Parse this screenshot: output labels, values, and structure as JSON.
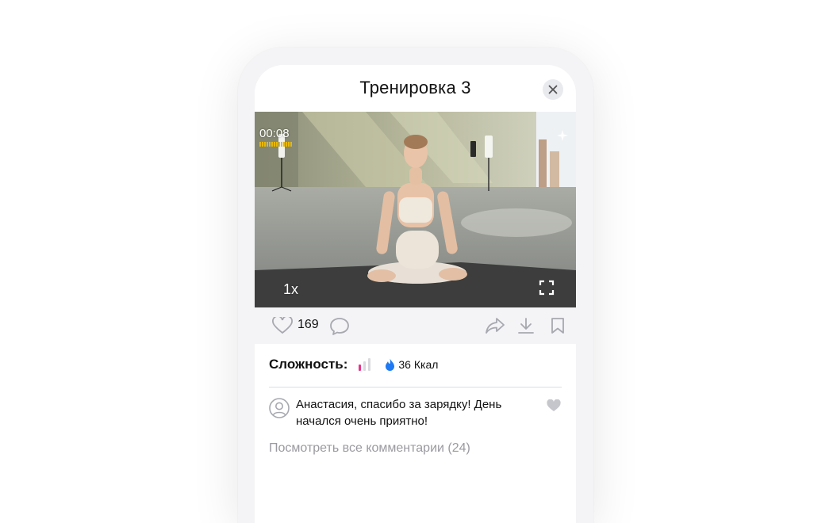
{
  "header": {
    "title": "Тренировка 3"
  },
  "video": {
    "time": "00:08",
    "speed": "1x"
  },
  "actions": {
    "like_count": "169"
  },
  "info": {
    "difficulty_label": "Сложность:",
    "difficulty_level": 1,
    "difficulty_max": 3,
    "calories": "36 Ккал"
  },
  "comment": {
    "text": "Анастасия, спасибо за зарядку! День начался очень приятно!"
  },
  "view_all_comments": "Посмотреть все комментарии (24)",
  "colors": {
    "accent_blue": "#1f7af3",
    "difficulty_active": "#e9328a",
    "difficulty_inactive": "#d9d9de",
    "volume_bar": "#e8b800"
  }
}
